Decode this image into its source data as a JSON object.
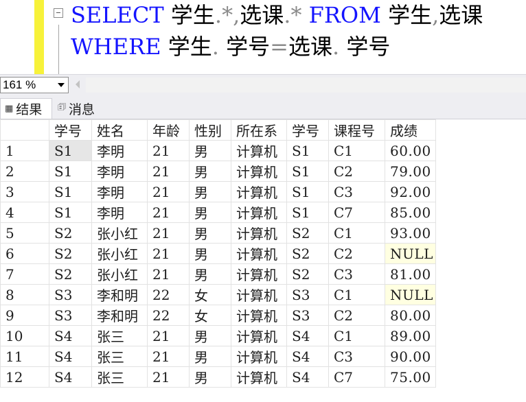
{
  "editor": {
    "line1": [
      {
        "t": "SELECT",
        "c": "kw"
      },
      {
        "t": " 学生",
        "c": "tx"
      },
      {
        "t": ".",
        "c": "op"
      },
      {
        "t": "*",
        "c": "op"
      },
      {
        "t": ",",
        "c": "op"
      },
      {
        "t": "选课",
        "c": "tx"
      },
      {
        "t": ".",
        "c": "op"
      },
      {
        "t": "*",
        "c": "op"
      },
      {
        "t": " FROM",
        "c": "kw"
      },
      {
        "t": " 学生",
        "c": "tx"
      },
      {
        "t": ",",
        "c": "op"
      },
      {
        "t": "选课",
        "c": "tx"
      }
    ],
    "line2": [
      {
        "t": "WHERE",
        "c": "kw"
      },
      {
        "t": " 学生",
        "c": "tx"
      },
      {
        "t": ".",
        "c": "op"
      },
      {
        "t": " 学号",
        "c": "tx"
      },
      {
        "t": "=",
        "c": "op"
      },
      {
        "t": "选课",
        "c": "tx"
      },
      {
        "t": ".",
        "c": "op"
      },
      {
        "t": " 学号",
        "c": "tx"
      }
    ]
  },
  "zoom": {
    "value": "161 %"
  },
  "tabs": {
    "results": "结果",
    "messages": "消息"
  },
  "grid": {
    "columns": [
      "",
      "学号",
      "姓名",
      "年龄",
      "性别",
      "所在系",
      "学号",
      "课程号",
      "成绩"
    ],
    "rows": [
      [
        "1",
        "S1",
        "李明",
        "21",
        "男",
        "计算机",
        "S1",
        "C1",
        "60.00"
      ],
      [
        "2",
        "S1",
        "李明",
        "21",
        "男",
        "计算机",
        "S1",
        "C2",
        "79.00"
      ],
      [
        "3",
        "S1",
        "李明",
        "21",
        "男",
        "计算机",
        "S1",
        "C3",
        "92.00"
      ],
      [
        "4",
        "S1",
        "李明",
        "21",
        "男",
        "计算机",
        "S1",
        "C7",
        "85.00"
      ],
      [
        "5",
        "S2",
        "张小红",
        "21",
        "男",
        "计算机",
        "S2",
        "C1",
        "93.00"
      ],
      [
        "6",
        "S2",
        "张小红",
        "21",
        "男",
        "计算机",
        "S2",
        "C2",
        "NULL"
      ],
      [
        "7",
        "S2",
        "张小红",
        "21",
        "男",
        "计算机",
        "S2",
        "C3",
        "81.00"
      ],
      [
        "8",
        "S3",
        "李和明",
        "22",
        "女",
        "计算机",
        "S3",
        "C1",
        "NULL"
      ],
      [
        "9",
        "S3",
        "李和明",
        "22",
        "女",
        "计算机",
        "S3",
        "C2",
        "80.00"
      ],
      [
        "10",
        "S4",
        "张三",
        "21",
        "男",
        "计算机",
        "S4",
        "C1",
        "89.00"
      ],
      [
        "11",
        "S4",
        "张三",
        "21",
        "男",
        "计算机",
        "S4",
        "C3",
        "90.00"
      ],
      [
        "12",
        "S4",
        "张三",
        "21",
        "男",
        "计算机",
        "S4",
        "C7",
        "75.00"
      ]
    ],
    "selected_cell": {
      "row": 0,
      "col": 1
    },
    "colors": {
      "null_bg": "#ffffe1",
      "keyword": "#1414ff",
      "change_bar": "#f7f23a"
    }
  }
}
